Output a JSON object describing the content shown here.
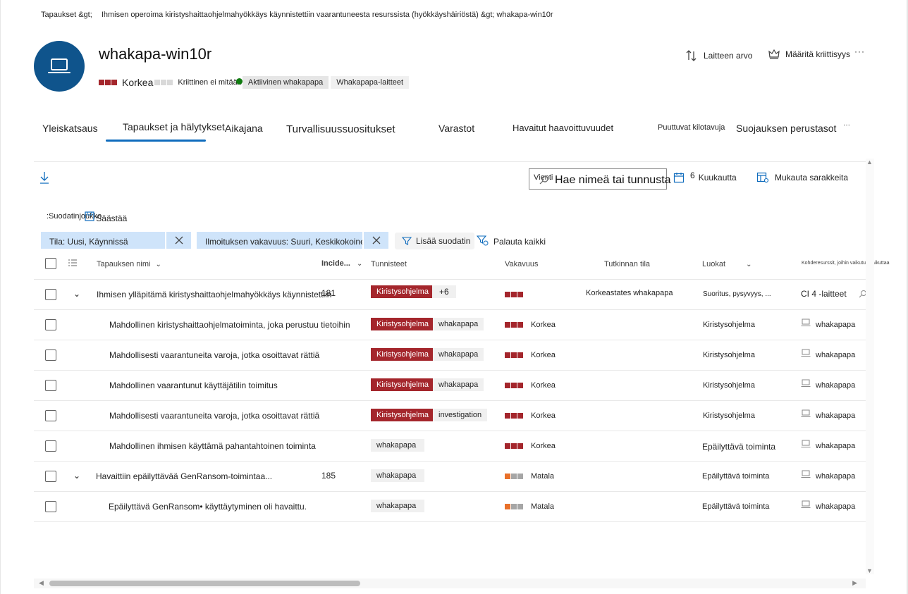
{
  "breadcrumb": {
    "items": [
      "Tapaukset &gt;",
      "Ihmisen operoima kiristyshaittaohjelmahyökkäys käynnistettiin vaarantuneesta resurssista (hyökkäyshäiriöstä) &gt; whakapa-win10r"
    ]
  },
  "device": {
    "title": "whakapa-win10r",
    "severity_label": "Korkea",
    "criticality_label": "Kriittinen ei mitään",
    "status_label": "Aktiivinen whakapapa",
    "group_label": "Whakapapa-laitteet"
  },
  "header_actions": {
    "device_value": "Laitteen arvo",
    "set_criticality": "Määritä kriittisyys",
    "more": "···"
  },
  "tabs": [
    "Yleiskatsaus",
    "Tapaukset ja hälytykset",
    "Aikajana",
    "Turvallisuussuositukset",
    "Varastot",
    "Havaitut haavoittuvuudet",
    "Puuttuvat kilotavuja",
    "Suojauksen perustasot"
  ],
  "tabs_more": "···",
  "toolbar": {
    "export_label": "Vienti",
    "search_placeholder": "Hae nimeä tai tunnusta",
    "period_number": "6",
    "period_label": "Kuukautta",
    "customize_columns": "Mukauta sarakkeita",
    "filter_set_label": ":Suodatinjoukko",
    "save_label": "Säästää",
    "add_filter": "Lisää suodatin",
    "reset_all": "Palauta kaikki"
  },
  "chips": [
    "Tila: Uusi, Käynnissä",
    "Ilmoituksen vakavuus: Suuri, Keskikokoinen, Pieni"
  ],
  "columns": {
    "name": "Tapauksen nimi",
    "incident": "Incide...",
    "tags": "Tunnisteet",
    "severity": "Vakavuus",
    "investigation": "Tutkinnan tila",
    "categories": "Luokat",
    "impacted": "Kohderesurssit, joihin vaikutus vaikuttaa"
  },
  "rows": [
    {
      "name": "Ihmisen ylläpitämä kiristyshaittaohjelmahyökkäys käynnistettiin",
      "id": "181",
      "tag1": "Kiristysohjelma",
      "tag2": "+6",
      "severity": "",
      "investigation": "Korkeastates whakapapa",
      "category": "Suoritus, pysyvyys, ...",
      "asset": "CI 4 -laitteet"
    },
    {
      "name": "Mahdollinen kiristyshaittaohjelmatoiminta, joka perustuu tietoihin",
      "id": "",
      "tag1": "Kiristysohjelma",
      "tag2": "whakapapa",
      "severity": "Korkea",
      "investigation": "",
      "category": "Kiristysohjelma",
      "asset": "whakapapa"
    },
    {
      "name": "Mahdollisesti vaarantuneita varoja, jotka osoittavat rättiä",
      "id": "",
      "tag1": "Kiristysohjelma",
      "tag2": "whakapapa",
      "severity": "Korkea",
      "investigation": "",
      "category": "Kiristysohjelma",
      "asset": "whakapapa"
    },
    {
      "name": "Mahdollinen vaarantunut käyttäjätilin toimitus",
      "id": "",
      "tag1": "Kiristysohjelma",
      "tag2": "whakapapa",
      "severity": "Korkea",
      "investigation": "",
      "category": "Kiristysohjelma",
      "asset": "whakapapa"
    },
    {
      "name": "Mahdollisesti vaarantuneita varoja, jotka osoittavat rättiä",
      "id": "",
      "tag1": "Kiristysohjelma",
      "tag2": "investigation",
      "severity": "Korkea",
      "investigation": "",
      "category": "Kiristysohjelma",
      "asset": "whakapapa"
    },
    {
      "name": "Mahdollinen ihmisen käyttämä pahantahtoinen toiminta",
      "id": "",
      "tag1": "whakapapa",
      "tag2": "",
      "severity": "Korkea",
      "investigation": "",
      "category": "Epäilyttävä toiminta",
      "asset": "whakapapa"
    },
    {
      "name": "Havaittiin epäilyttävää GenRansom-toimintaa...",
      "id": "185",
      "tag1": "whakapapa",
      "tag2": "",
      "severity": "Matala",
      "investigation": "",
      "category": "Epäilyttävä toiminta",
      "asset": "whakapapa"
    },
    {
      "name": "Epäilyttävä GenRansom• käyttäytyminen oli havaittu.",
      "id": "",
      "tag1": "whakapapa",
      "tag2": "",
      "severity": "Matala",
      "investigation": "",
      "category": "Epäilyttävä toiminta",
      "asset": "whakapapa"
    }
  ],
  "colors": {
    "accent": "#0f6cbd",
    "avatar": "#0f548c",
    "high": "#a4262c",
    "low": "#e8702a",
    "chip": "#cfe4fa"
  }
}
